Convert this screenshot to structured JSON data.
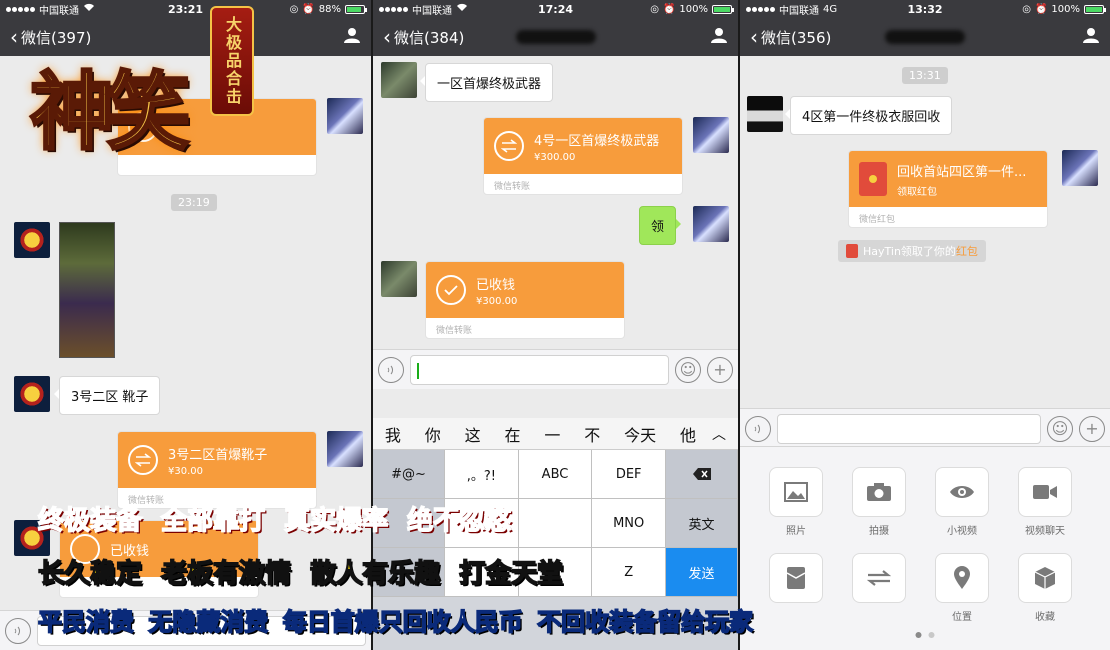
{
  "panels": [
    {
      "status": {
        "carrier": "中国联通",
        "network": "",
        "time": "23:21",
        "battery": "88%"
      },
      "nav": {
        "back_label": "微信(397)"
      },
      "time_pill": "23:19",
      "messages": {
        "text_boots": "3号二区 靴子",
        "transfer1": {
          "title": "3号二区首爆靴子",
          "amount": "¥30.00",
          "footer": "微信转账"
        },
        "transfer2": {
          "title": "已收钱"
        }
      }
    },
    {
      "status": {
        "carrier": "中国联通",
        "network": "",
        "time": "17:24",
        "battery": "100%"
      },
      "nav": {
        "back_label": "微信(384)"
      },
      "messages": {
        "text1": "一区首爆终极武器",
        "transfer1": {
          "title": "4号一区首爆终极武器",
          "amount": "¥300.00",
          "footer": "微信转账"
        },
        "green": "领",
        "transfer2": {
          "title": "已收钱",
          "amount": "¥300.00",
          "footer": "微信转账"
        }
      },
      "keyboard": {
        "candidates": [
          "我",
          "你",
          "这",
          "在",
          "一",
          "不",
          "今天",
          "他"
        ],
        "row1": [
          "#@~",
          ",。?!",
          "ABC",
          "DEF"
        ],
        "row2": [
          "MNO",
          "英文"
        ],
        "row3": [
          "Z"
        ],
        "send": "发送"
      }
    },
    {
      "status": {
        "carrier": "中国联通",
        "network": "4G",
        "time": "13:32",
        "battery": "100%"
      },
      "nav": {
        "back_label": "微信(356)"
      },
      "time_pill": "13:31",
      "messages": {
        "text1": "4区第一件终极衣服回收",
        "redpack": {
          "title": "回收首站四区第一件...",
          "sub": "领取红包",
          "footer": "微信红包"
        },
        "notice_prefix": "HayTin领取了你的",
        "notice_highlight": "红包"
      },
      "plus_panel": {
        "tiles": [
          {
            "label": "照片",
            "icon": "photo-icon"
          },
          {
            "label": "拍摄",
            "icon": "camera-icon"
          },
          {
            "label": "小视频",
            "icon": "eye-icon"
          },
          {
            "label": "视频聊天",
            "icon": "video-call-icon"
          },
          {
            "label": "",
            "icon": "red-packet-icon"
          },
          {
            "label": "",
            "icon": "transfer-icon"
          },
          {
            "label": "位置",
            "icon": "location-icon"
          },
          {
            "label": "收藏",
            "icon": "favorites-icon"
          }
        ]
      }
    }
  ],
  "overlay": {
    "logo_text": "神笑",
    "logo_badge": "大极品合击",
    "promo_line1": "终极装备 全部靠打 真实爆率 绝不忽悠",
    "promo_line2": "长久稳定 老板有激情 散人有乐趣 打金天堂",
    "promo_line3": "平民消费 无隐藏消费 每日首爆只回收人民币 不回收装备留给玩家"
  },
  "colors": {
    "wechat_orange": "#f79c3c",
    "wechat_green_bubble": "#a0e75a",
    "nav_dark": "#3a3a3e",
    "chat_bg": "#ebebeb"
  }
}
